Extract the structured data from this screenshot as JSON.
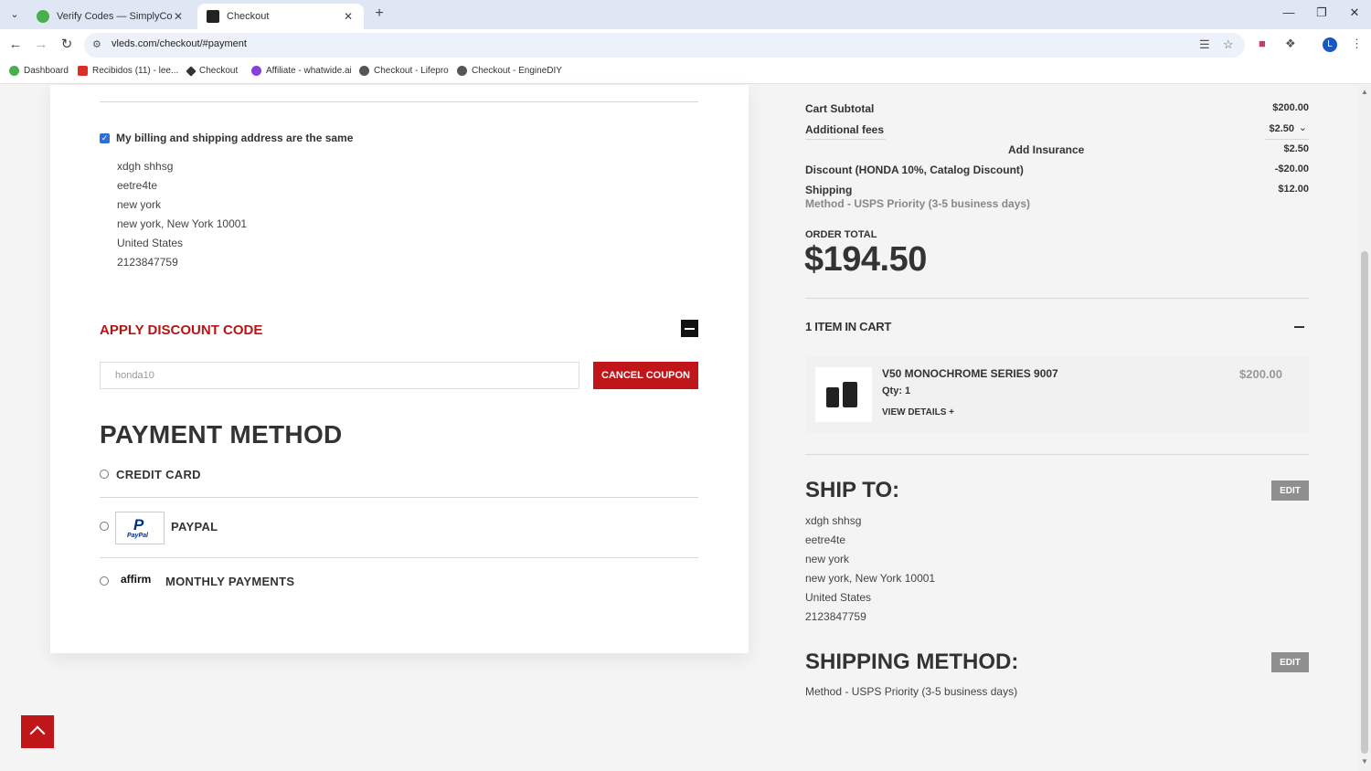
{
  "browser": {
    "tabs": [
      {
        "title": "Verify Codes — SimplyCodes",
        "active": false
      },
      {
        "title": "Checkout",
        "active": true
      }
    ],
    "url": "vleds.com/checkout/#payment",
    "profile_initial": "L",
    "bookmarks": [
      "Dashboard",
      "Recibidos (11) - lee...",
      "Checkout",
      "Affiliate - whatwide.ai",
      "Checkout - Lifepro",
      "Checkout - EngineDIY"
    ]
  },
  "billing": {
    "same_label": "My billing and shipping address are the same",
    "address": [
      "xdgh shhsg",
      "eetre4te",
      "new york",
      "new york, New York 10001",
      "United States",
      "2123847759"
    ]
  },
  "discount": {
    "title": "APPLY DISCOUNT CODE",
    "code": "honda10",
    "cancel_label": "CANCEL COUPON"
  },
  "payment": {
    "title": "PAYMENT METHOD",
    "options": [
      "CREDIT CARD",
      "PAYPAL",
      "MONTHLY PAYMENTS"
    ],
    "paypal_logo": "P",
    "paypal_text": "PayPal",
    "affirm_logo": "affirm"
  },
  "summary": {
    "rows": [
      {
        "label": "Cart Subtotal",
        "value": "$200.00"
      },
      {
        "label": "Additional fees",
        "value": "$2.50"
      },
      {
        "label": "Add Insurance",
        "value": "$2.50"
      },
      {
        "label": "Discount (HONDA 10%, Catalog Discount)",
        "value": "-$20.00"
      },
      {
        "label": "Shipping",
        "value": "$12.00"
      }
    ],
    "shipping_method_sub": "Method - USPS Priority (3-5 business days)",
    "order_total_label": "ORDER TOTAL",
    "order_total": "$194.50"
  },
  "cart": {
    "title": "1 ITEM IN CART",
    "item": {
      "name": "V50 MONOCHROME SERIES 9007",
      "qty": "Qty: 1",
      "details_label": "VIEW DETAILS",
      "price": "$200.00"
    }
  },
  "ship_to": {
    "title": "SHIP TO:",
    "edit_label": "EDIT",
    "address": [
      "xdgh shhsg",
      "eetre4te",
      "new york",
      "new york, New York 10001",
      "United States",
      "2123847759"
    ]
  },
  "shipping_method": {
    "title": "SHIPPING METHOD:",
    "edit_label": "EDIT",
    "value": "Method - USPS Priority (3-5 business days)"
  },
  "colors": {
    "accent_red": "#c0161a",
    "checkbox_blue": "#2a6fdb"
  }
}
